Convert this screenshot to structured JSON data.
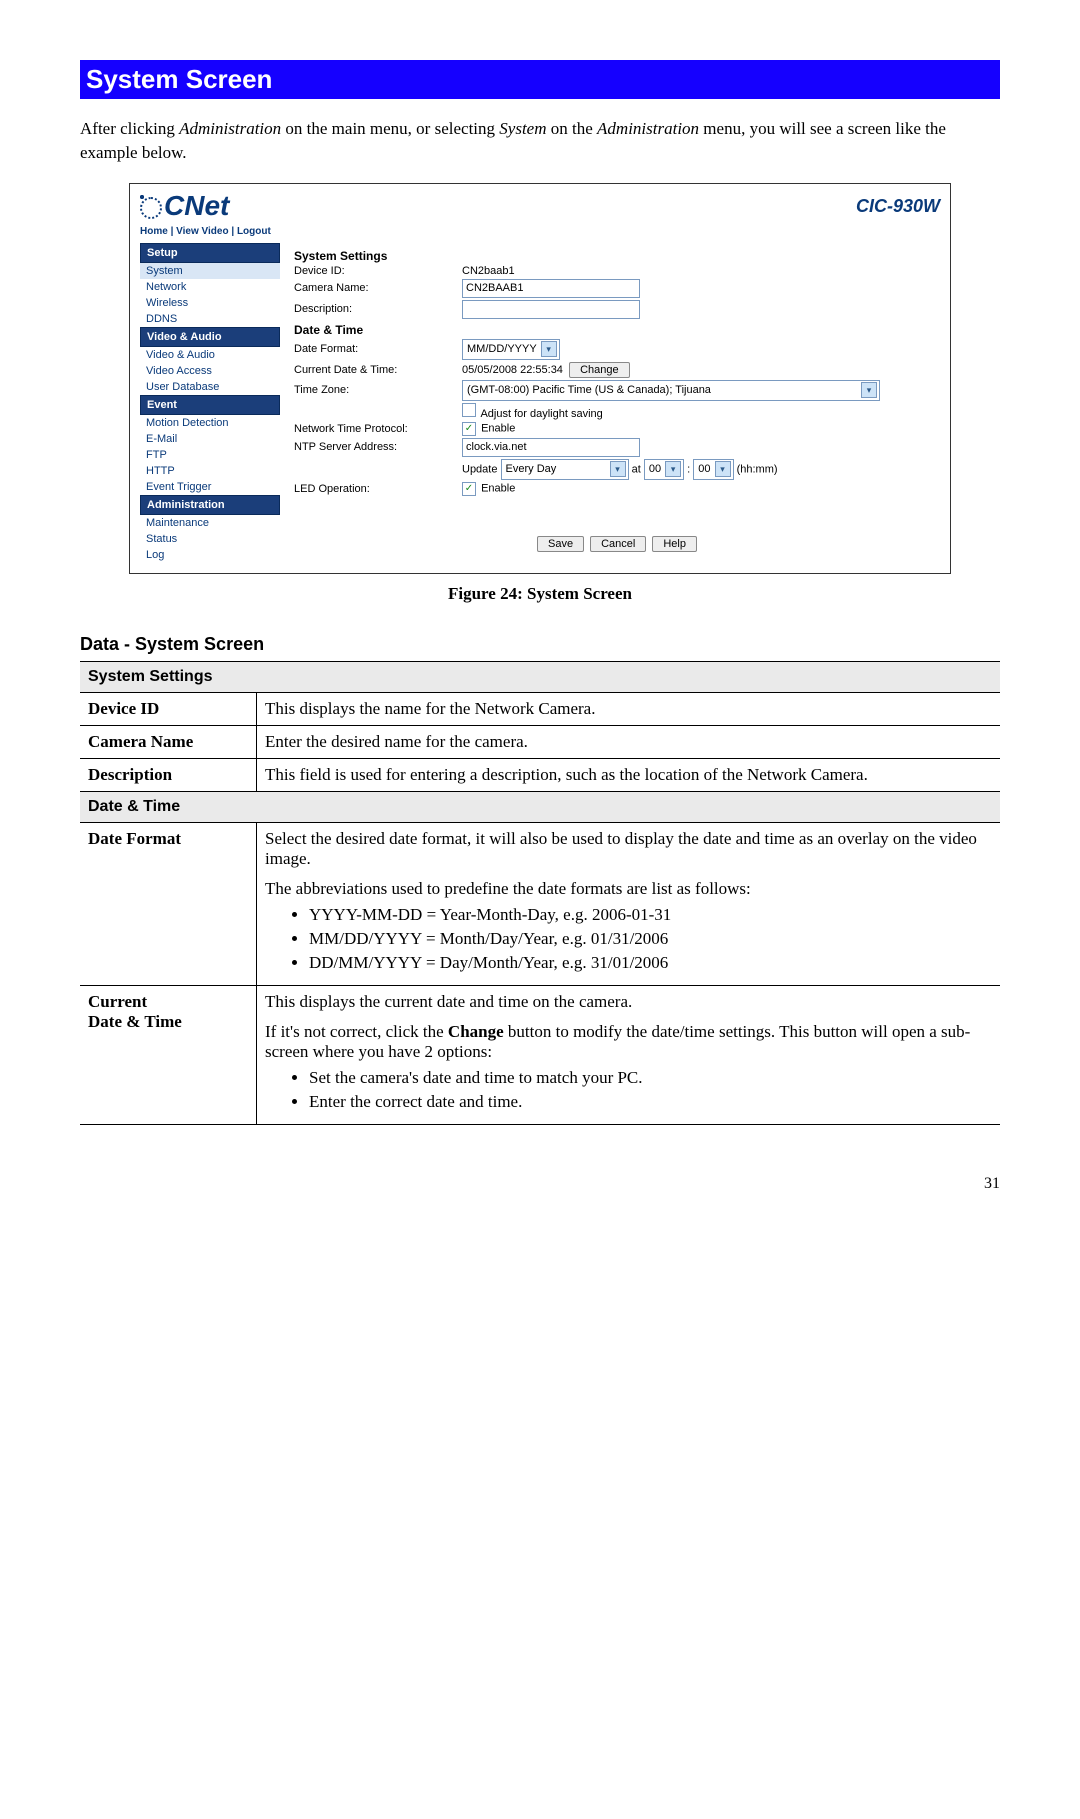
{
  "page_title": "System Screen",
  "intro_parts": {
    "p1": "After clicking ",
    "i1": "Administration",
    "p2": " on the main menu, or selecting ",
    "i2": "System",
    "p3": " on the ",
    "i3": "Administration",
    "p4": " menu, you will see a screen like the example below."
  },
  "screenshot": {
    "logo_text": "CNet",
    "model": "CIC-930W",
    "breadcrumb": {
      "home": "Home",
      "view_video": "View Video",
      "logout": "Logout",
      "sep": " | "
    },
    "nav": {
      "setup": {
        "header": "Setup",
        "items": [
          "System",
          "Network",
          "Wireless",
          "DDNS"
        ],
        "active": "System"
      },
      "video_audio": {
        "header": "Video & Audio",
        "items": [
          "Video & Audio",
          "Video Access",
          "User Database"
        ]
      },
      "event": {
        "header": "Event",
        "items": [
          "Motion Detection",
          "E-Mail",
          "FTP",
          "HTTP",
          "Event Trigger"
        ]
      },
      "admin": {
        "header": "Administration",
        "items": [
          "Maintenance",
          "Status",
          "Log"
        ]
      }
    },
    "settings": {
      "heading": "System Settings",
      "device_id_label": "Device ID:",
      "device_id_value": "CN2baab1",
      "camera_name_label": "Camera Name:",
      "camera_name_value": "CN2BAAB1",
      "description_label": "Description:",
      "description_value": "",
      "datetime_heading": "Date & Time",
      "date_format_label": "Date Format:",
      "date_format_value": "MM/DD/YYYY",
      "current_dt_label": "Current Date & Time:",
      "current_dt_value": "05/05/2008  22:55:34",
      "change_button": "Change",
      "timezone_label": "Time Zone:",
      "timezone_value": "(GMT-08:00) Pacific Time (US & Canada); Tijuana",
      "daylight_label": "Adjust for daylight saving",
      "ntp_label": "Network Time Protocol:",
      "ntp_enable": "Enable",
      "ntp_server_label": "NTP Server Address:",
      "ntp_server_value": "clock.via.net",
      "update_label": "Update",
      "update_freq": "Every Day",
      "at_label": " at ",
      "hh": "00",
      "colon": " : ",
      "mm": "00",
      "hhmm_hint": " (hh:mm)",
      "led_label": "LED Operation:",
      "led_enable": "Enable",
      "save": "Save",
      "cancel": "Cancel",
      "help": "Help"
    }
  },
  "figure_caption": "Figure 24: System Screen",
  "data_heading": "Data - System Screen",
  "table": {
    "section1": "System Settings",
    "device_id": {
      "label": "Device ID",
      "desc": "This displays the name for the Network Camera."
    },
    "camera_name": {
      "label": "Camera Name",
      "desc": "Enter the desired name for the camera."
    },
    "description": {
      "label": "Description",
      "desc": "This field is used for entering a description, such as the location of the Network Camera."
    },
    "section2": "Date & Time",
    "date_format": {
      "label": "Date Format",
      "p1": "Select the desired date format, it will also be used to display the date and time as an overlay on the video image.",
      "p2": "The abbreviations used to predefine the date formats are list as follows:",
      "li1": "YYYY-MM-DD = Year-Month-Day, e.g. 2006-01-31",
      "li2": "MM/DD/YYYY = Month/Day/Year, e.g. 01/31/2006",
      "li3": "DD/MM/YYYY = Day/Month/Year, e.g. 31/01/2006"
    },
    "current_dt": {
      "label1": "Current",
      "label2": "Date & Time",
      "p1": "This displays the current date and time on the camera.",
      "p2a": "If it's not correct, click the ",
      "p2bold": "Change",
      "p2b": " button to modify the date/time settings. This button will open a sub-screen where you have 2 options:",
      "li1": "Set the camera's date and time to match your PC.",
      "li2": "Enter the correct date and time."
    }
  },
  "page_number": "31"
}
